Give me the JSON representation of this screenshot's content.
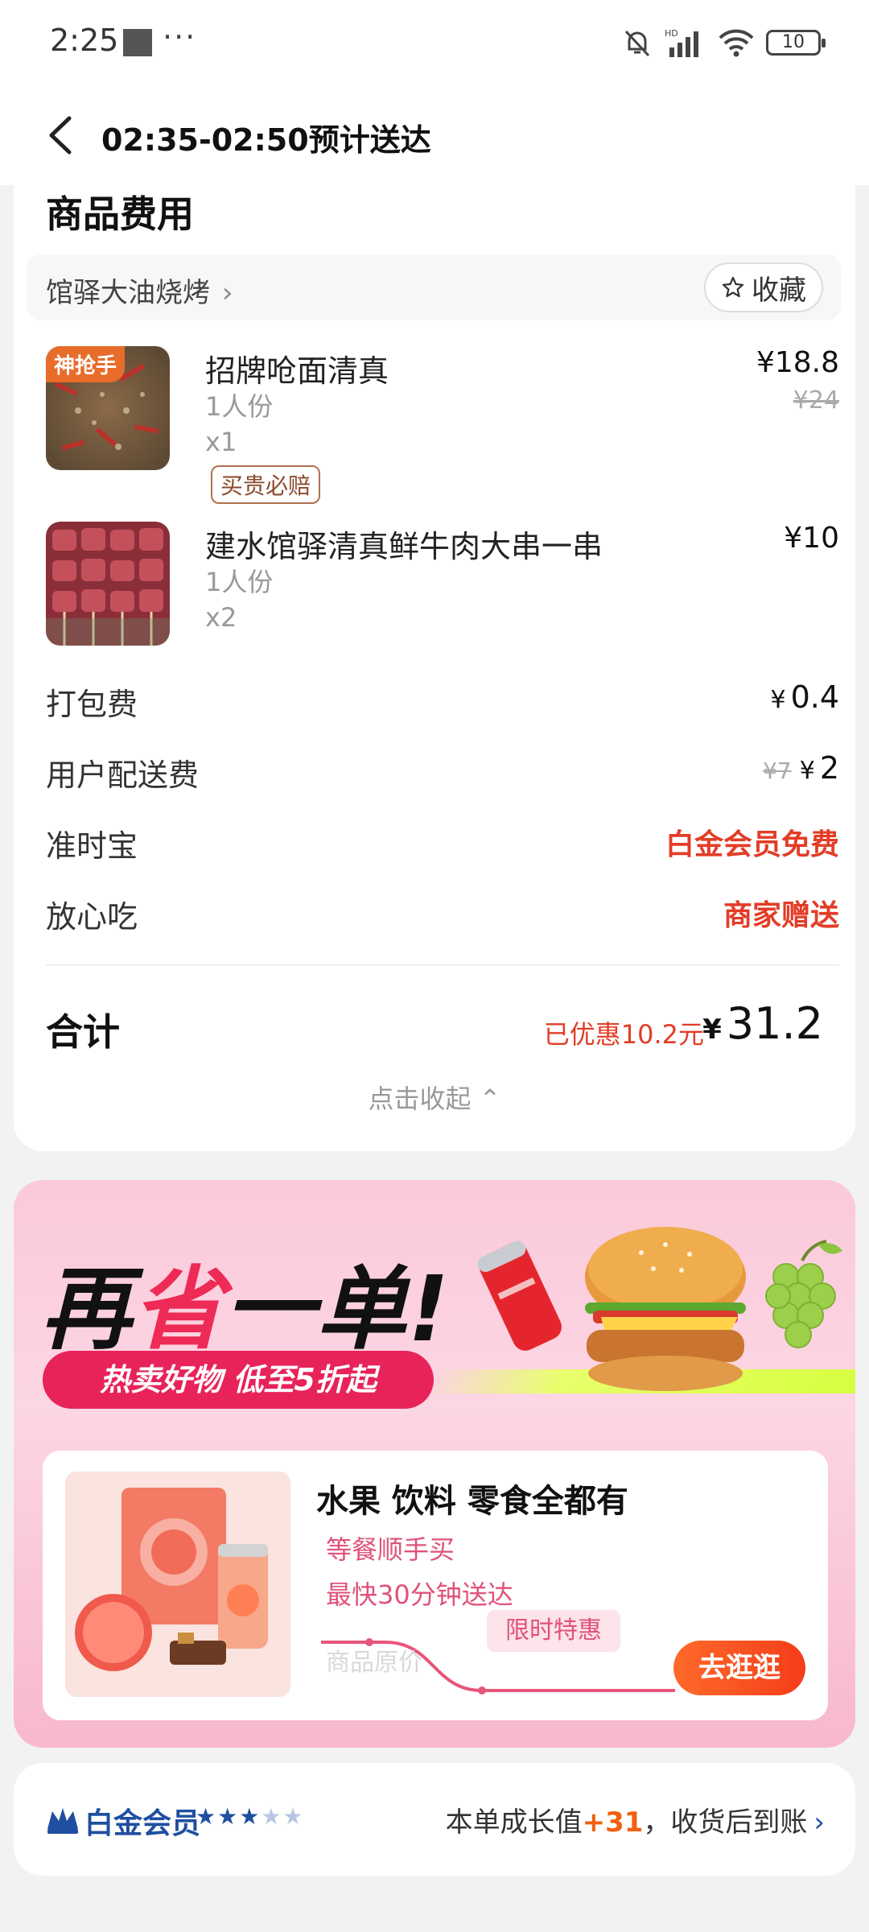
{
  "status_bar": {
    "time": "2:25",
    "more": "···",
    "battery": "10"
  },
  "header": {
    "title": "02:35-02:50预计送达"
  },
  "fees": {
    "section_title": "商品费用",
    "shop_name": "馆驿大油烧烤",
    "shop_chevron": "›",
    "favorite_label": "收藏",
    "items": [
      {
        "tag": "神抢手",
        "name": "招牌呛面清真",
        "portion": "1人份",
        "qty": "x1",
        "badge": "买贵必赔",
        "price": "¥18.8",
        "original_price": "¥24"
      },
      {
        "tag": "",
        "name": "建水馆驿清真鲜牛肉大串一串",
        "portion": "1人份",
        "qty": "x2",
        "badge": "",
        "price": "¥10",
        "original_price": ""
      }
    ],
    "rows": {
      "packing": {
        "label": "打包费",
        "yen": "¥",
        "value": "0.4"
      },
      "delivery": {
        "label": "用户配送费",
        "original": "¥7",
        "yen": "¥",
        "value": "2"
      },
      "ontime": {
        "label": "准时宝",
        "value": "白金会员免费"
      },
      "assured": {
        "label": "放心吃",
        "value": "商家赠送"
      }
    },
    "total": {
      "label": "合计",
      "saved": "已优惠10.2元",
      "yen": "¥",
      "value": "31.2"
    },
    "collapse": "点击收起 ⌃"
  },
  "promo": {
    "headline_1": "再",
    "headline_2": "省",
    "headline_3": "一单!",
    "pill": "热卖好物 低至5折起",
    "card": {
      "title": "水果 饮料 零食全都有",
      "sub1": "等餐顺手买",
      "sub2": "最快30分钟送达",
      "original_price_label": "商品原价",
      "limited": "限时特惠",
      "button": "去逛逛"
    }
  },
  "member": {
    "name": "白金会员",
    "stars_filled": "★★★",
    "stars_empty": "★★",
    "growth_prefix": "本单成长值",
    "growth_value": "+31",
    "growth_suffix": "，收货后到账",
    "chevron": "›"
  },
  "colors": {
    "accent_red": "#e23d27",
    "member_blue": "#1f4fa0",
    "promo_pink": "#e8235a",
    "button_orange": "#f43d1a"
  }
}
